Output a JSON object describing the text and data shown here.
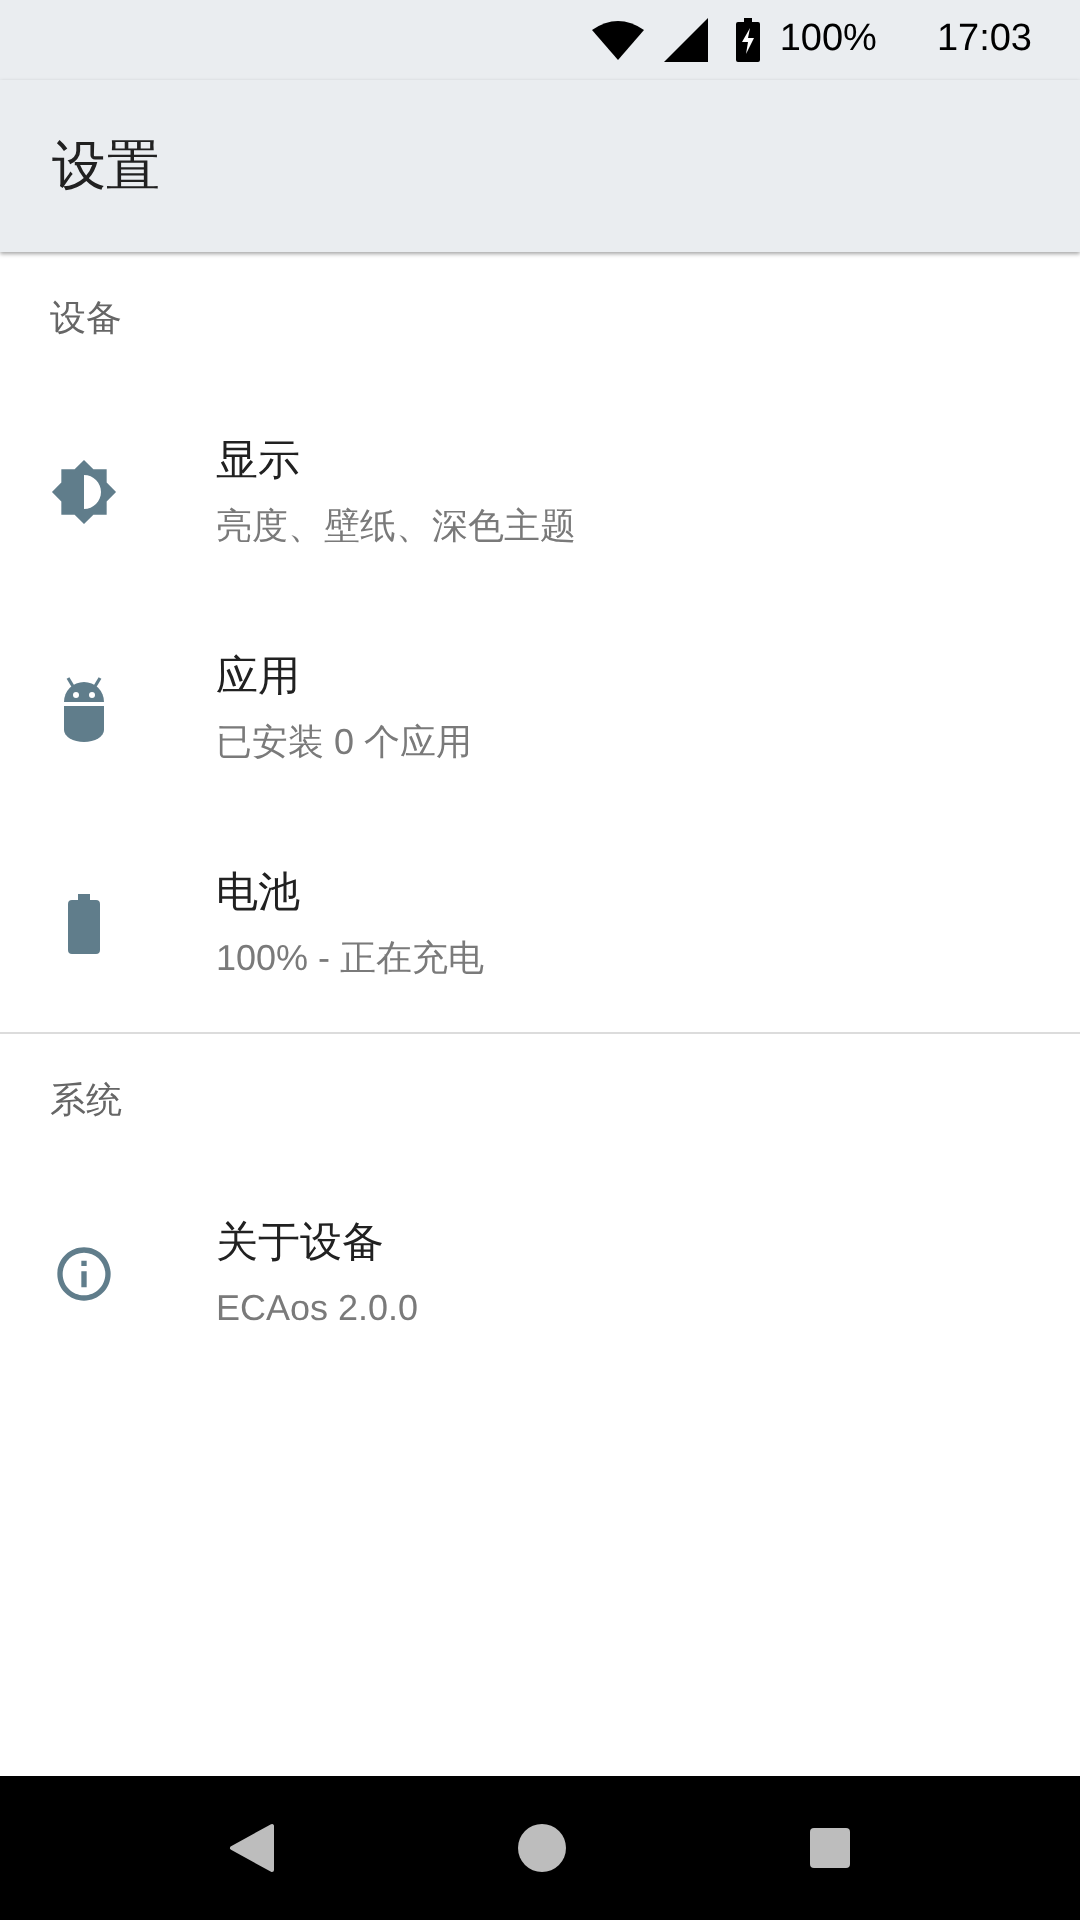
{
  "status_bar": {
    "battery": "100%",
    "time": "17:03"
  },
  "app_bar": {
    "title": "设置"
  },
  "sections": [
    {
      "header": "设备",
      "items": [
        {
          "kind": "display",
          "title": "显示",
          "subtitle": "亮度、壁纸、深色主题"
        },
        {
          "kind": "apps",
          "title": "应用",
          "subtitle": "已安装 0 个应用"
        },
        {
          "kind": "battery",
          "title": "电池",
          "subtitle": "100% - 正在充电"
        }
      ]
    },
    {
      "header": "系统",
      "items": [
        {
          "kind": "info",
          "title": "关于设备",
          "subtitle": "ECAos 2.0.0"
        }
      ]
    }
  ]
}
